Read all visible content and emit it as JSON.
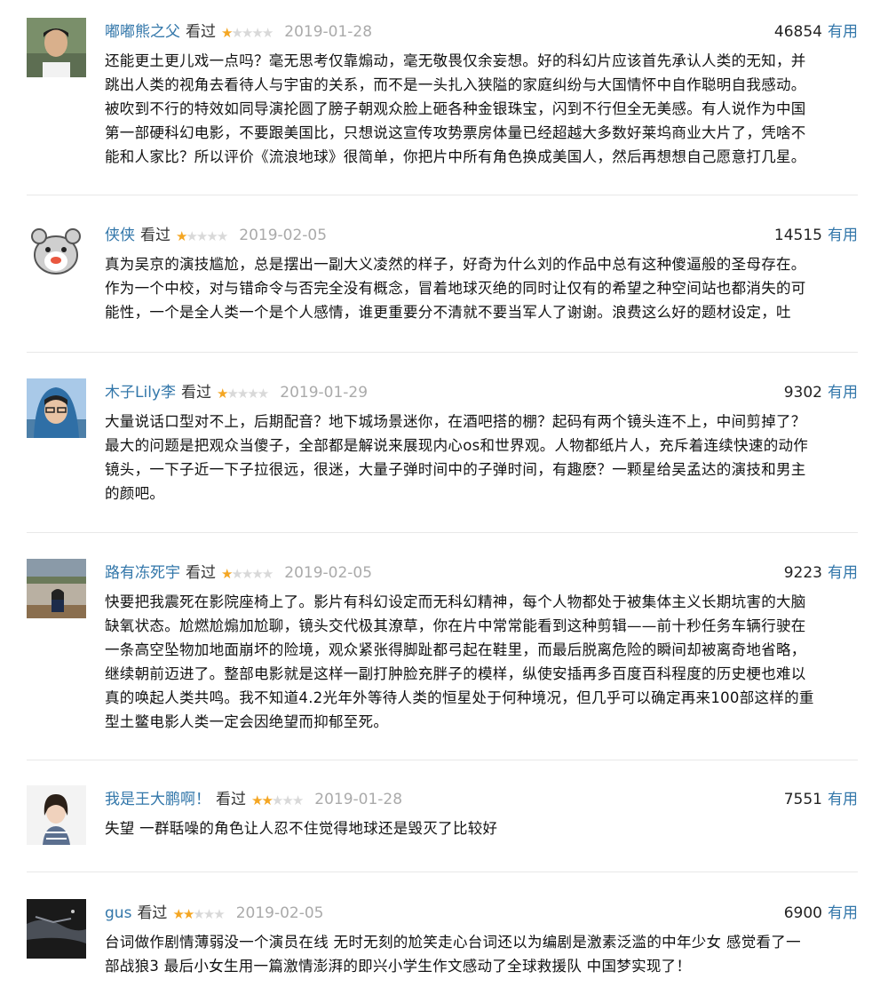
{
  "reviews": [
    {
      "user": "嘟嘟熊之父",
      "status": "看过",
      "rating": 1,
      "date": "2019-01-28",
      "votes": "46854",
      "useful_label": "有用",
      "lines": [
        "还能更土更儿戏一点吗？毫无思考仅靠煽动，毫无敬畏仅余妄想。好的科幻片应该首先承认人类的无知，并",
        "跳出人类的视角去看待人与宇宙的关系，而不是一头扎入狭隘的家庭纠纷与大国情怀中自作聪明自我感动。",
        "被吹到不行的特效如同导演抡圆了膀子朝观众脸上砸各种金银珠宝，闪到不行但全无美感。有人说作为中国",
        "第一部硬科幻电影，不要跟美国比，只想说这宣传攻势票房体量已经超越大多数好莱坞商业大片了，凭啥不",
        "能和人家比？所以评价《流浪地球》很简单，你把片中所有角色换成美国人，然后再想想自己愿意打几星。"
      ]
    },
    {
      "user": "侠侠",
      "status": "看过",
      "rating": 1,
      "date": "2019-02-05",
      "votes": "14515",
      "useful_label": "有用",
      "lines": [
        "真为吴京的演技尴尬，总是摆出一副大义凌然的样子，好奇为什么刘的作品中总有这种傻逼般的圣母存在。",
        "作为一个中校，对与错命令与否完全没有概念，冒着地球灭绝的同时让仅有的希望之种空间站也都消失的可",
        "能性，一个是全人类一个是个人感情，谁更重要分不清就不要当军人了谢谢。浪费这么好的题材设定，吐"
      ]
    },
    {
      "user": "木子Lily李",
      "status": "看过",
      "rating": 1,
      "date": "2019-01-29",
      "votes": "9302",
      "useful_label": "有用",
      "lines": [
        "大量说话口型对不上，后期配音？地下城场景迷你，在酒吧搭的棚？起码有两个镜头连不上，中间剪掉了？",
        "最大的问题是把观众当傻子，全部都是解说来展现内心os和世界观。人物都纸片人，充斥着连续快速的动作",
        "镜头，一下子近一下子拉很远，很迷，大量子弹时间中的子弹时间，有趣麽？一颗星给吴孟达的演技和男主",
        "的颜吧。"
      ]
    },
    {
      "user": "路有冻死宇",
      "status": "看过",
      "rating": 1,
      "date": "2019-02-05",
      "votes": "9223",
      "useful_label": "有用",
      "lines": [
        "快要把我震死在影院座椅上了。影片有科幻设定而无科幻精神，每个人物都处于被集体主义长期坑害的大脑",
        "缺氧状态。尬燃尬煽加尬聊，镜头交代极其潦草，你在片中常常能看到这种剪辑——前十秒任务车辆行驶在",
        "一条高空坠物加地面崩坏的险境，观众紧张得脚趾都弓起在鞋里，而最后脱离危险的瞬间却被离奇地省略，",
        "继续朝前迈进了。整部电影就是这样一副打肿脸充胖子的模样，纵使安插再多百度百科程度的历史梗也难以",
        "真的唤起人类共鸣。我不知道4.2光年外等待人类的恒星处于何种境况，但几乎可以确定再来100部这样的重",
        "型土鳖电影人类一定会因绝望而抑郁至死。"
      ]
    },
    {
      "user": "我是王大鹏啊！",
      "status": "看过",
      "rating": 2,
      "date": "2019-01-28",
      "votes": "7551",
      "useful_label": "有用",
      "lines": [
        "失望 一群聒噪的角色让人忍不住觉得地球还是毁灭了比较好"
      ]
    },
    {
      "user": "gus",
      "status": "看过",
      "rating": 2,
      "date": "2019-02-05",
      "votes": "6900",
      "useful_label": "有用",
      "lines": [
        "台词做作剧情薄弱没一个演员在线 无时无刻的尬笑走心台词还以为编剧是激素泛滥的中年少女 感觉看了一",
        "部战狼3 最后小女生用一篇激情澎湃的即兴小学生作文感动了全球救援队 中国梦实现了！"
      ]
    }
  ],
  "star_max": 5,
  "colors": {
    "link": "#3377aa",
    "star_on": "#f4a623",
    "star_off": "#d9d9d9",
    "date": "#aaaaaa"
  }
}
